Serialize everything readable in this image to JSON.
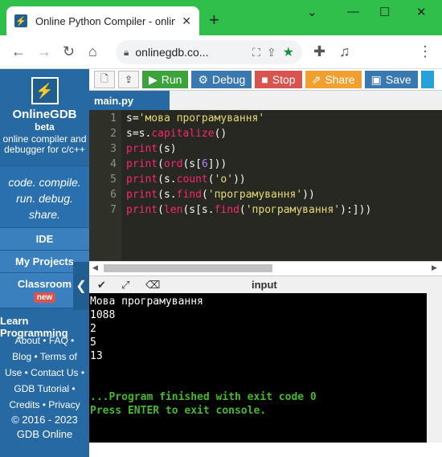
{
  "browser": {
    "tab_title": "Online Python Compiler - online",
    "tab_favicon": "onlinegdb-icon",
    "new_tab": "+",
    "url": "onlinegdb.co...",
    "win_min": "⌄",
    "win_minimize": "—",
    "win_max": "☐",
    "win_close": "✕"
  },
  "sidebar": {
    "brand": "OnlineGDB",
    "beta": "beta",
    "tagline": "online compiler and debugger for c/c++",
    "motto_lines": [
      "code. compile.",
      "run. debug.",
      "share."
    ],
    "ide": "IDE",
    "projects": "My Projects",
    "classroom": "Classroom",
    "new_badge": "new",
    "learn": "Learn Programming",
    "footer": [
      "About • FAQ •",
      "Blog • Terms of",
      "Use • Contact Us •",
      "GDB Tutorial •",
      "Credits • Privacy"
    ],
    "copyright": "© 2016 - 2023",
    "org": "GDB Online"
  },
  "toolbar": {
    "run": "Run",
    "debug": "Debug",
    "stop": "Stop",
    "share": "Share",
    "save": "Save"
  },
  "editor": {
    "file_tab": "main.py",
    "line_numbers": [
      "1",
      "2",
      "3",
      "4",
      "5",
      "6",
      "7"
    ]
  },
  "io": {
    "label": "input"
  },
  "console": {
    "lines": [
      "Мова програмування",
      "1088",
      "2",
      "5",
      "13"
    ],
    "finished": "...Program finished with exit code 0",
    "press_enter": "Press ENTER to exit console."
  },
  "colors": {
    "sidebar_bg": "#2769a3",
    "run_btn": "#3ca33c",
    "stop_btn": "#d9534f",
    "share_btn": "#f0a030",
    "editor_bg": "#272822",
    "console_green": "#46b82e"
  }
}
